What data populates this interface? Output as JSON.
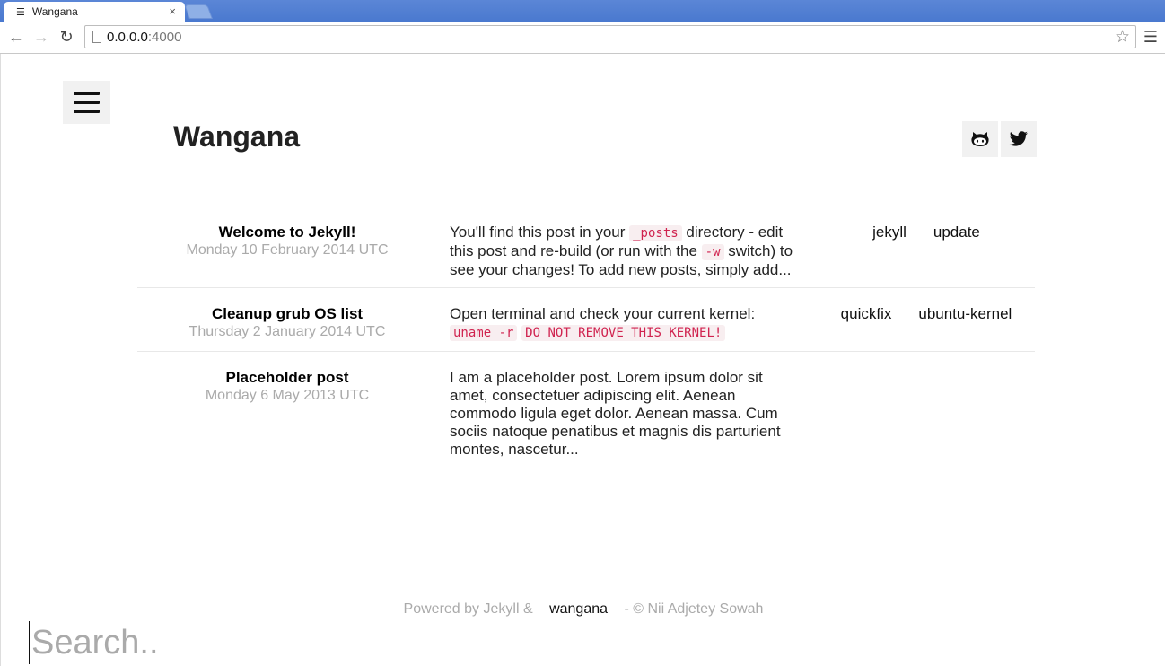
{
  "browser": {
    "tab_title": "Wangana",
    "tab_close": "×",
    "url_host": "0.0.0.0",
    "url_port": ":4000"
  },
  "site": {
    "title": "Wangana",
    "social": [
      "github-icon",
      "twitter-icon"
    ]
  },
  "posts": [
    {
      "title": "Welcome to Jekyll!",
      "date": "Monday 10 February 2014 UTC",
      "excerpt_parts": [
        "You'll find this post in your ",
        "_posts",
        " directory - edit this post and re-build (or run with the ",
        "-w",
        " switch) to see your changes! To add new posts, simply add..."
      ],
      "tags": [
        "jekyll",
        "update"
      ]
    },
    {
      "title": "Cleanup grub OS list",
      "date": "Thursday 2 January 2014 UTC",
      "excerpt_parts": [
        "Open terminal and check your current kernel: ",
        "uname -r",
        "DO NOT REMOVE THIS KERNEL!"
      ],
      "tags": [
        "quickfix",
        "ubuntu-kernel"
      ]
    },
    {
      "title": "Placeholder post",
      "date": "Monday 6 May 2013 UTC",
      "excerpt": "I am a placeholder post. Lorem ipsum dolor sit amet, consectetuer adipiscing elit. Aenean commodo ligula eget dolor. Aenean massa. Cum sociis natoque penatibus et magnis dis parturient montes, nascetur...",
      "tags": []
    }
  ],
  "footer": {
    "prefix": "Powered by Jekyll &",
    "brand": "wangana",
    "suffix": "- © Nii Adjetey Sowah"
  },
  "search": {
    "placeholder": "Search.."
  },
  "colors": {
    "tab_bar": "#4a79cf",
    "code_text": "#d0234f",
    "muted": "#aaaaaa"
  }
}
